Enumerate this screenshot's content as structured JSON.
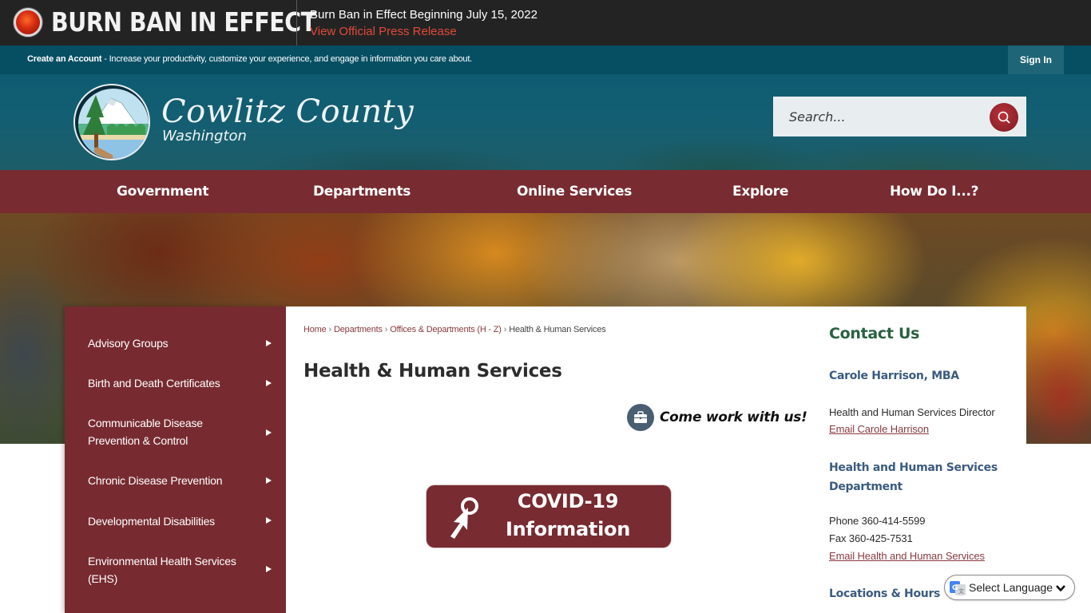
{
  "alert": {
    "title": "BURN BAN IN EFFECT",
    "message": "Burn Ban in Effect Beginning July 15, 2022",
    "link_label": "View Official Press Release",
    "indicator_color": "#d42a10"
  },
  "account_bar": {
    "create_label": "Create an Account",
    "message": " - Increase your productivity, customize your experience, and engage in information you care about.",
    "sign_in_label": "Sign In"
  },
  "header": {
    "site_name": "Cowlitz County",
    "site_subtitle": "Washington",
    "logo_icon": "county-seal-icon"
  },
  "search": {
    "placeholder": "Search...",
    "value": "",
    "button_icon": "search-icon"
  },
  "nav": {
    "items": [
      {
        "label": "Government"
      },
      {
        "label": "Departments"
      },
      {
        "label": "Online Services"
      },
      {
        "label": "Explore"
      },
      {
        "label": "How Do I...?"
      }
    ]
  },
  "sidebar": {
    "items": [
      {
        "label": "Advisory Groups"
      },
      {
        "label": "Birth and Death Certificates"
      },
      {
        "label": "Communicable Disease Prevention & Control"
      },
      {
        "label": "Chronic Disease Prevention"
      },
      {
        "label": "Developmental Disabilities"
      },
      {
        "label": "Environmental Health Services (EHS)"
      }
    ]
  },
  "breadcrumb": {
    "items": [
      {
        "label": "Home"
      },
      {
        "label": "Departments"
      },
      {
        "label": "Offices & Departments (H - Z)"
      }
    ],
    "current": "Health & Human Services",
    "separator": "›"
  },
  "main": {
    "title": "Health & Human Services",
    "work_link_label": "Come work with us!",
    "covid_line1": "COVID-19",
    "covid_line2": "Information"
  },
  "contact": {
    "heading": "Contact Us",
    "person_name": "Carole Harrison, MBA",
    "person_title": "Health and Human Services Director",
    "person_email_label": "Email Carole Harrison",
    "department_heading": "Health and Human Services Department",
    "phone": "Phone 360-414-5599",
    "fax": "Fax 360-425-7531",
    "department_email_label": "Email Health and Human Services",
    "locations_heading": "Locations & Hours"
  },
  "language": {
    "label": "Select Language"
  },
  "colors": {
    "brand_maroon": "#782b31",
    "header_teal": "#064f63",
    "alert_dark": "#232323",
    "contact_heading_green": "#2a6141",
    "contact_subhead_blue": "#3b5b80",
    "link_maroon": "#8a3a3f"
  }
}
